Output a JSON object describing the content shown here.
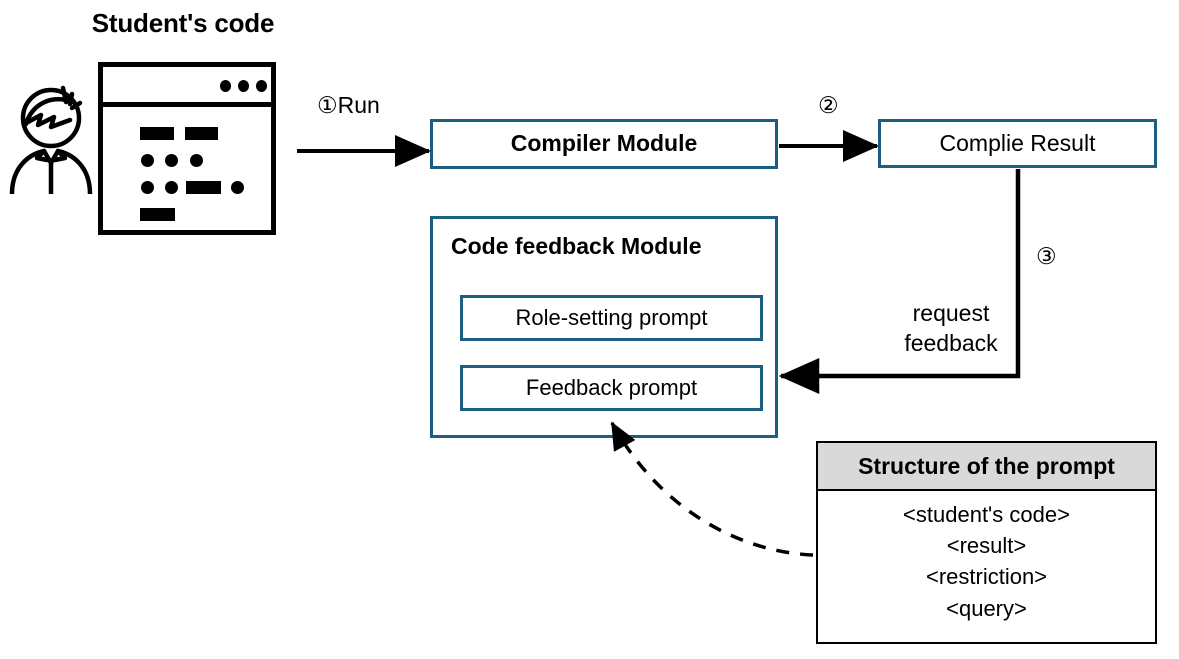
{
  "diagram": {
    "title": "Student's code",
    "colors": {
      "box_border": "#1d5f80",
      "table_border": "#000000",
      "table_header_fill": "#d9d9d9",
      "connector": "#000000",
      "background": "#ffffff"
    },
    "actor": {
      "name": "student-avatar"
    },
    "code_window": {
      "name": "student-code-window",
      "title_dots": 3
    },
    "nodes": [
      {
        "id": "compiler_module",
        "label": "Compiler Module",
        "bold": true
      },
      {
        "id": "compile_result",
        "label": "Complie Result",
        "bold": false
      },
      {
        "id": "code_feedback_module",
        "label": "Code feedback Module",
        "bold": true
      },
      {
        "id": "role_setting_prompt",
        "label": "Role-setting prompt",
        "bold": false
      },
      {
        "id": "feedback_prompt",
        "label": "Feedback prompt",
        "bold": false
      }
    ],
    "edges": [
      {
        "id": "e1",
        "label": "①Run",
        "from": "student_code",
        "to": "compiler_module"
      },
      {
        "id": "e2",
        "label": "②",
        "from": "compiler_module",
        "to": "compile_result"
      },
      {
        "id": "e3",
        "label": "③",
        "sublabel_line1": "request",
        "sublabel_line2": "feedback",
        "from": "compile_result",
        "to": "code_feedback_module"
      },
      {
        "id": "e4",
        "label": "",
        "from": "structure_of_the_prompt",
        "to": "feedback_prompt",
        "style": "dashed"
      }
    ],
    "structure_table": {
      "header": "Structure of the prompt",
      "rows": [
        "<student's code>",
        "<result>",
        "<restriction>",
        "<query>"
      ]
    }
  }
}
